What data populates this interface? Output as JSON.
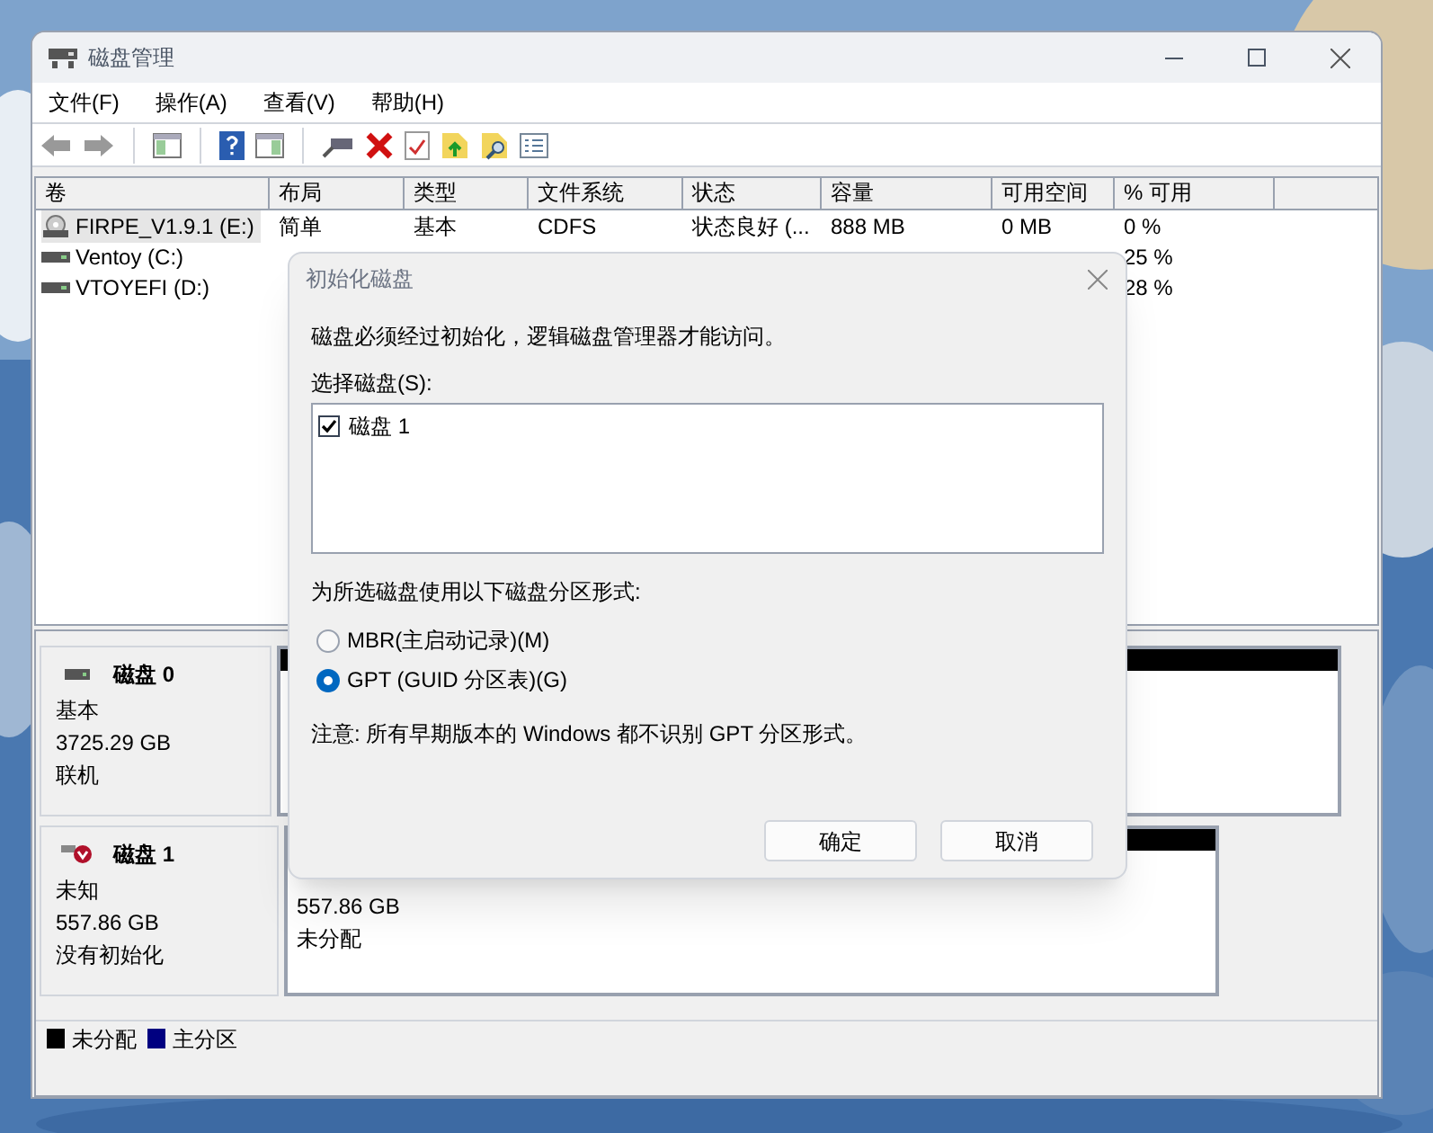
{
  "window": {
    "title": "磁盘管理"
  },
  "menu": [
    "文件(F)",
    "操作(A)",
    "查看(V)",
    "帮助(H)"
  ],
  "volume_table": {
    "columns": [
      "卷",
      "布局",
      "类型",
      "文件系统",
      "状态",
      "容量",
      "可用空间",
      "% 可用"
    ],
    "rows": [
      {
        "kind": "cd",
        "selected": true,
        "cells": [
          "FIRPE_V1.9.1 (E:)",
          "简单",
          "基本",
          "CDFS",
          "状态良好 (...",
          "888 MB",
          "0 MB",
          "0 %"
        ]
      },
      {
        "kind": "drive",
        "selected": false,
        "cells": [
          "Ventoy (C:)",
          null,
          null,
          null,
          null,
          null,
          null,
          "25 %"
        ]
      },
      {
        "kind": "drive",
        "selected": false,
        "cells": [
          "VTOYEFI (D:)",
          null,
          null,
          null,
          null,
          null,
          null,
          "28 %"
        ]
      }
    ]
  },
  "disks": [
    {
      "kind": "basic",
      "name": "磁盘 0",
      "type": "基本",
      "size": "3725.29 GB",
      "status": "联机",
      "partitions": [
        {
          "color": "#000000"
        }
      ]
    },
    {
      "kind": "unknown",
      "name": "磁盘 1",
      "type": "未知",
      "size": "557.86 GB",
      "status": "没有初始化",
      "partitions": [
        {
          "color": "#000000",
          "size": "557.86 GB",
          "label": "未分配"
        }
      ]
    }
  ],
  "legend": [
    {
      "label": "未分配",
      "color": "#000000"
    },
    {
      "label": "主分区",
      "color": "#000080"
    }
  ],
  "dialog": {
    "title": "初始化磁盘",
    "message": "磁盘必须经过初始化，逻辑磁盘管理器才能访问。",
    "list_label": "选择磁盘(S):",
    "disk_items": [
      {
        "label": "磁盘 1",
        "checked": true
      }
    ],
    "style_label": "为所选磁盘使用以下磁盘分区形式:",
    "styles": [
      {
        "label": "MBR(主启动记录)(M)",
        "selected": false
      },
      {
        "label": "GPT (GUID 分区表)(G)",
        "selected": true
      }
    ],
    "note": "注意: 所有早期版本的 Windows 都不识别 GPT 分区形式。",
    "buttons": [
      "确定",
      "取消"
    ]
  }
}
